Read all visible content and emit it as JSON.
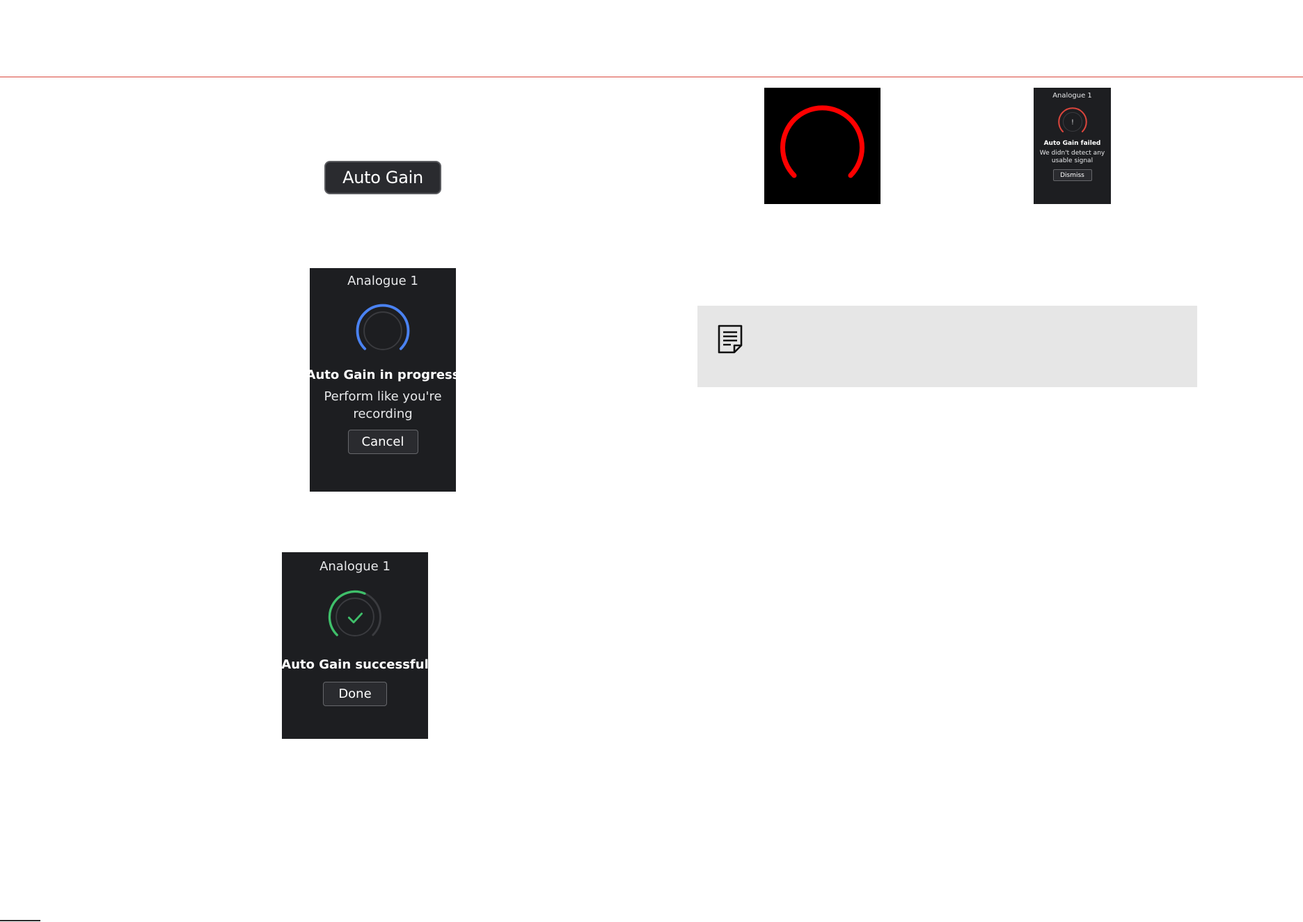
{
  "auto_gain_button": {
    "label": "Auto Gain"
  },
  "panel_progress": {
    "title": "Analogue 1",
    "heading": "Auto Gain in progress",
    "message_line1": "Perform like you're",
    "message_line2": "recording",
    "button": "Cancel",
    "ring_color": "#4a82f2"
  },
  "panel_success": {
    "title": "Analogue 1",
    "heading": "Auto Gain successful",
    "button": "Done",
    "ring_color": "#3fbf6a",
    "knob_icon": "checkmark-icon"
  },
  "red_ring_image": {
    "ring_color": "#ff0000"
  },
  "panel_failed": {
    "title": "Analogue 1",
    "knob_icon": "!",
    "heading": "Auto Gain failed",
    "message_line1": "We didn't detect any",
    "message_line2": "usable signal",
    "button": "Dismiss",
    "ring_color": "#d9453c"
  },
  "note": {
    "icon": "note-icon"
  },
  "colors": {
    "accent_rule": "#d9453c",
    "panel_background": "#1d1e21",
    "note_background": "#e6e6e6"
  }
}
